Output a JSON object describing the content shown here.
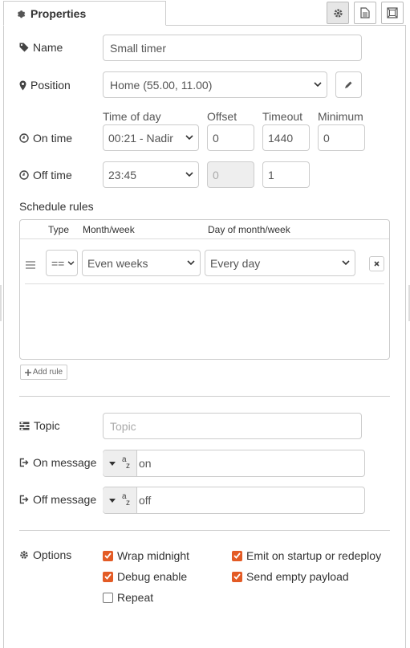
{
  "tab": {
    "title": "Properties"
  },
  "name": {
    "label": "Name",
    "value": "Small timer"
  },
  "position": {
    "label": "Position",
    "value": "Home (55.00, 11.00)"
  },
  "columns": {
    "time_of_day": "Time of day",
    "offset": "Offset",
    "timeout": "Timeout",
    "minimum": "Minimum"
  },
  "on_time": {
    "label": "On time",
    "time": "00:21 - Nadir",
    "offset": "0",
    "timeout": "1440",
    "minimum": "0"
  },
  "off_time": {
    "label": "Off time",
    "time": "23:45",
    "offset": "0",
    "minimum": "1"
  },
  "schedule": {
    "label": "Schedule rules",
    "headers": {
      "type": "Type",
      "month_week": "Month/week",
      "day": "Day of month/week"
    },
    "rows": [
      {
        "op": "==",
        "month_week": "Even weeks",
        "day": "Every day"
      }
    ],
    "add_rule": "Add rule"
  },
  "topic": {
    "label": "Topic",
    "placeholder": "Topic"
  },
  "on_message": {
    "label": "On message",
    "type_glyph_top": "a",
    "type_glyph_bottom": "z",
    "value": "on"
  },
  "off_message": {
    "label": "Off message",
    "type_glyph_top": "a",
    "type_glyph_bottom": "z",
    "value": "off"
  },
  "options": {
    "label": "Options",
    "items": [
      {
        "label": "Wrap midnight",
        "checked": true
      },
      {
        "label": "Emit on startup or redeploy",
        "checked": true
      },
      {
        "label": "Debug enable",
        "checked": true
      },
      {
        "label": "Send empty payload",
        "checked": true
      },
      {
        "label": "Repeat",
        "checked": false
      }
    ]
  },
  "colors": {
    "accent_checkbox": "#e35b25"
  }
}
